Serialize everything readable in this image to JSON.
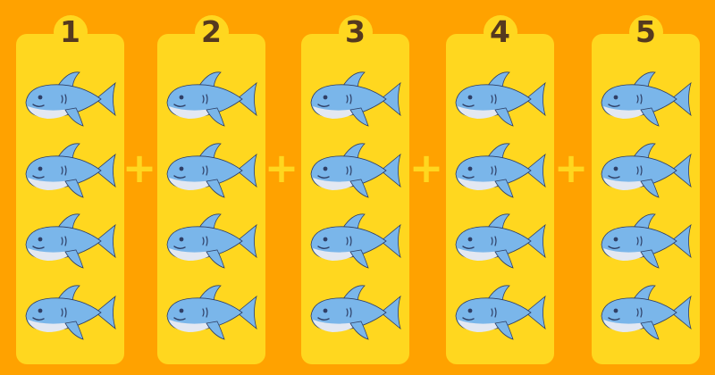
{
  "columns": [
    {
      "label": "1",
      "shark_count": 4
    },
    {
      "label": "2",
      "shark_count": 4
    },
    {
      "label": "3",
      "shark_count": 4
    },
    {
      "label": "4",
      "shark_count": 4
    },
    {
      "label": "5",
      "shark_count": 4
    }
  ],
  "operator": "+",
  "colors": {
    "background": "#FFA200",
    "panel": "#FFD71F",
    "label_text": "#55391F",
    "operator": "#FFD71F",
    "shark_body": "#7AB6EA",
    "shark_belly": "#E3E8F2",
    "shark_outline": "#2F3F66"
  },
  "icons": {
    "item": "shark-icon"
  }
}
